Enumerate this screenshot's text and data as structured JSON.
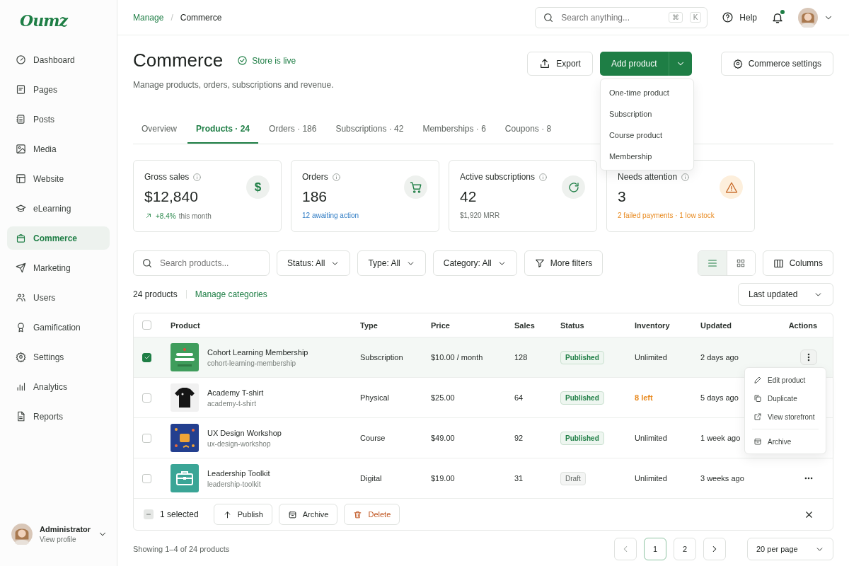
{
  "brand": {
    "logo": "Oumz"
  },
  "sidebar": {
    "items": [
      {
        "label": "Dashboard",
        "selected": false
      },
      {
        "label": "Pages",
        "selected": false
      },
      {
        "label": "Posts",
        "selected": false
      },
      {
        "label": "Media",
        "selected": false
      },
      {
        "label": "Website",
        "selected": false
      },
      {
        "label": "eLearning",
        "selected": false
      },
      {
        "label": "Commerce",
        "selected": true
      },
      {
        "label": "Marketing",
        "selected": false
      },
      {
        "label": "Users",
        "selected": false
      },
      {
        "label": "Gamification",
        "selected": false
      },
      {
        "label": "Settings",
        "selected": false
      },
      {
        "label": "Analytics",
        "selected": false
      },
      {
        "label": "Reports",
        "selected": false
      }
    ],
    "user": {
      "name": "Administrator",
      "link": "View profile"
    }
  },
  "topbar": {
    "breadcrumb": [
      "Manage",
      "Commerce"
    ],
    "breadcrumb_separator": "/",
    "search": {
      "placeholder": "Search anything...",
      "shortcut": [
        "⌘",
        "K"
      ]
    },
    "help": "Help",
    "notifications": {
      "unread": true
    }
  },
  "page": {
    "title": "Commerce",
    "status": "Store is live",
    "subtitle": "Manage products, orders, subscriptions and revenue."
  },
  "actions": {
    "export": "Export",
    "add": "Add product",
    "add_menu": {
      "expanded": true,
      "items": [
        "One-time product",
        "Subscription",
        "Course product",
        "Membership"
      ]
    },
    "settings": "Commerce settings"
  },
  "tabs": [
    {
      "label": "Overview",
      "selected": false
    },
    {
      "label": "Products · 24",
      "selected": true
    },
    {
      "label": "Orders · 186",
      "selected": false
    },
    {
      "label": "Subscriptions · 42",
      "selected": false
    },
    {
      "label": "Memberships · 6",
      "selected": false
    },
    {
      "label": "Coupons · 8",
      "selected": false
    }
  ],
  "stats": [
    {
      "label": "Gross sales",
      "value": "$12,840",
      "icon_glyph": "$",
      "trend": "+8.4%",
      "note": "this month",
      "kind": "positive"
    },
    {
      "label": "Orders",
      "value": "186",
      "note": "12 awaiting action",
      "kind": "link"
    },
    {
      "label": "Active subscriptions",
      "value": "42",
      "note": "$1,920 MRR",
      "kind": "muted"
    },
    {
      "label": "Needs attention",
      "value": "3",
      "note": "2 failed payments · 1 low stock",
      "kind": "warning"
    }
  ],
  "filters": {
    "search_placeholder": "Search products...",
    "dropdowns": [
      "Status: All",
      "Type: All",
      "Category: All"
    ],
    "more": "More filters",
    "views": [
      {
        "selected": true
      },
      {
        "selected": false
      }
    ],
    "columns": "Columns"
  },
  "summary": {
    "count": "24 products",
    "manage": "Manage categories",
    "sort": "Last updated"
  },
  "table": {
    "all_checked": false,
    "columns": [
      "Product",
      "Type",
      "Price",
      "Sales",
      "Status",
      "Inventory",
      "Updated",
      "Actions"
    ],
    "rows": [
      {
        "checked": true,
        "name": "Cohort Learning Membership",
        "slug": "cohort-learning-membership",
        "type": "Subscription",
        "price": "$10.00 / month",
        "sales": "128",
        "status": {
          "label": "Published",
          "kind": "published"
        },
        "inventory": "Unlimited",
        "inventory_low": false,
        "updated": "2 days ago",
        "menu_open": true
      },
      {
        "checked": false,
        "name": "Academy T-shirt",
        "slug": "academy-t-shirt",
        "type": "Physical",
        "price": "$25.00",
        "sales": "64",
        "status": {
          "label": "Published",
          "kind": "published"
        },
        "inventory": "8 left",
        "inventory_low": true,
        "updated": "5 days ago"
      },
      {
        "checked": false,
        "name": "UX Design Workshop",
        "slug": "ux-design-workshop",
        "type": "Course",
        "price": "$49.00",
        "sales": "92",
        "status": {
          "label": "Published",
          "kind": "published"
        },
        "inventory": "Unlimited",
        "inventory_low": false,
        "updated": "1 week ago"
      },
      {
        "checked": false,
        "name": "Leadership Toolkit",
        "slug": "leadership-toolkit",
        "type": "Digital",
        "price": "$19.00",
        "sales": "31",
        "status": {
          "label": "Draft",
          "kind": "draft"
        },
        "inventory": "Unlimited",
        "inventory_low": false,
        "updated": "3 weeks ago",
        "menu_open": false
      }
    ],
    "row_menu": [
      {
        "label": "Edit product",
        "separated": false
      },
      {
        "label": "Duplicate",
        "separated": false
      },
      {
        "label": "View storefront",
        "separated": false
      },
      {
        "label": "Archive",
        "separated": true
      }
    ]
  },
  "bulk": {
    "partial": true,
    "count": "1 selected",
    "buttons": [
      {
        "label": "Publish",
        "kind": "normal"
      },
      {
        "label": "Archive",
        "kind": "normal"
      },
      {
        "label": "Delete",
        "kind": "danger"
      }
    ]
  },
  "footer": {
    "showing": "Showing 1–4 of 24 products",
    "pages": [
      {
        "label": "1",
        "selected": true
      },
      {
        "label": "2",
        "selected": false
      }
    ],
    "per_page": "20 per page"
  }
}
